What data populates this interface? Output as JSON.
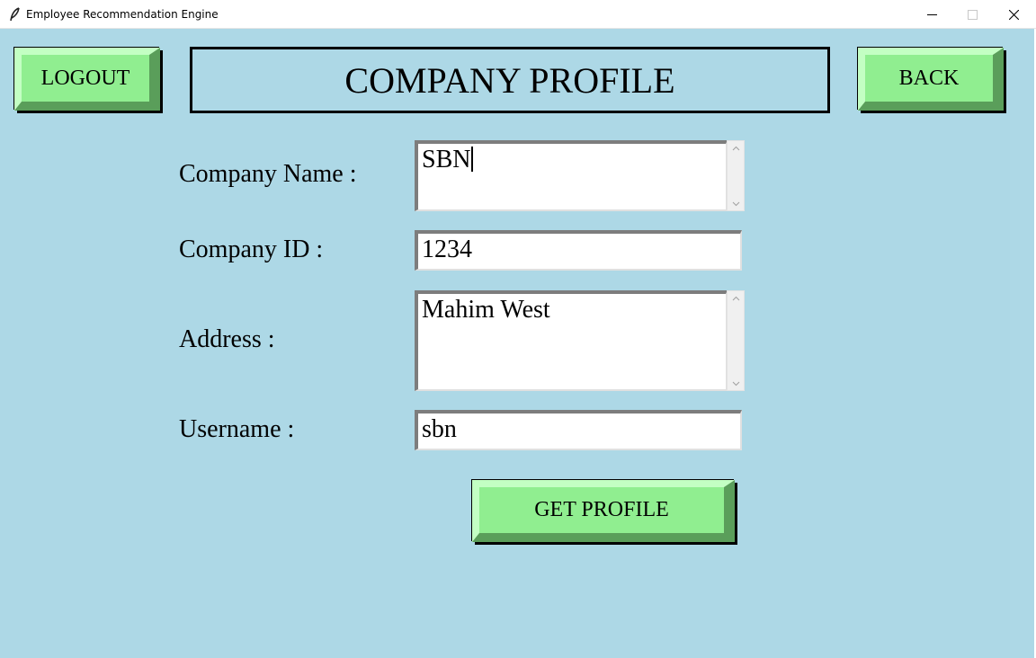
{
  "window": {
    "title": "Employee Recommendation Engine"
  },
  "header": {
    "logout_label": "LOGOUT",
    "title": "COMPANY PROFILE",
    "back_label": "BACK"
  },
  "form": {
    "company_name": {
      "label": "Company Name :",
      "value": "SBN"
    },
    "company_id": {
      "label": "Company ID :",
      "value": "1234"
    },
    "address": {
      "label": "Address :",
      "value": "Mahim West"
    },
    "username": {
      "label": "Username :",
      "value": "sbn"
    },
    "submit_label": "GET PROFILE"
  },
  "icons": {
    "app": "feather-icon",
    "minimize": "minimize-icon",
    "maximize": "maximize-icon",
    "close": "close-icon",
    "scroll_up": "chevron-up-icon",
    "scroll_down": "chevron-down-icon"
  },
  "colors": {
    "background": "#add8e6",
    "button": "#90ee90",
    "field": "#ffffff",
    "text": "#000000"
  }
}
